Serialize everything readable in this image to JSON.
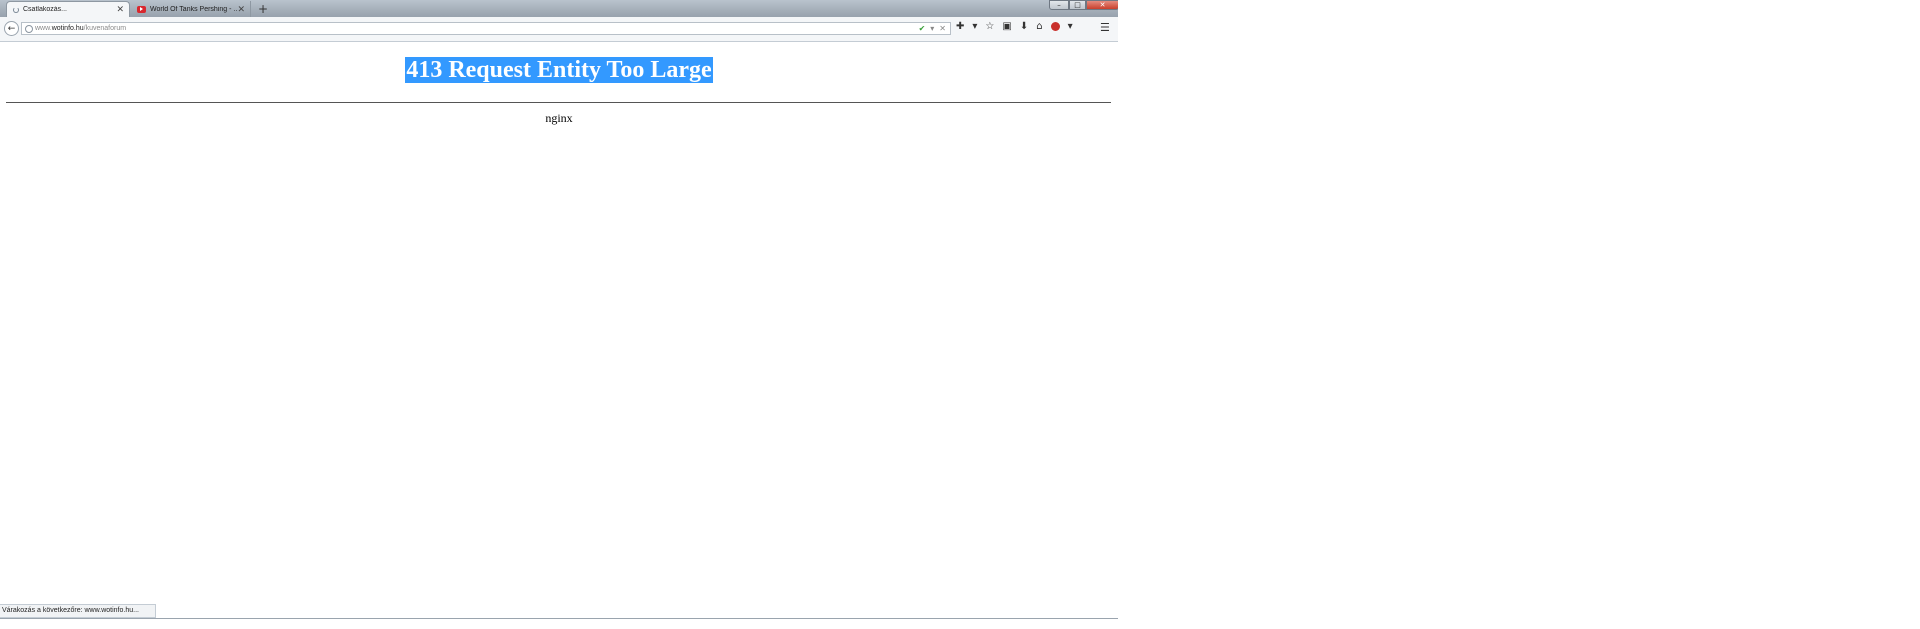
{
  "tabs": [
    {
      "label": "Csatlakozás...",
      "active": true,
      "icon": "loading-spinner-icon"
    },
    {
      "label": "World Of Tanks Pershing - ...",
      "active": false,
      "icon": "youtube-icon"
    }
  ],
  "new_tab_symbol": "+",
  "window_controls": {
    "minimize": "–",
    "maximize": "□",
    "close": "✕"
  },
  "navigation": {
    "back_symbol": "←",
    "url_prefix": "www.",
    "url_domain": "wotinfo.hu",
    "url_path": "/kuvenaforum",
    "ok_symbol": "✔",
    "dropdown_symbol": "▾",
    "stop_symbol": "✕"
  },
  "toolbar": {
    "extension_symbol": "✚",
    "dropdown_symbol": "▾",
    "bookmark_symbol": "☆",
    "clipboard_symbol": "▣",
    "download_symbol": "⬇",
    "home_symbol": "⌂",
    "menu_symbol": "☰"
  },
  "page": {
    "heading": "413 Request Entity Too Large",
    "server": "nginx"
  },
  "status_bar": "Várakozás a következőre: www.wotinfo.hu...",
  "colors": {
    "selection": "#3399ff",
    "abp_red": "#c9302c",
    "youtube_red": "#d9272e"
  }
}
